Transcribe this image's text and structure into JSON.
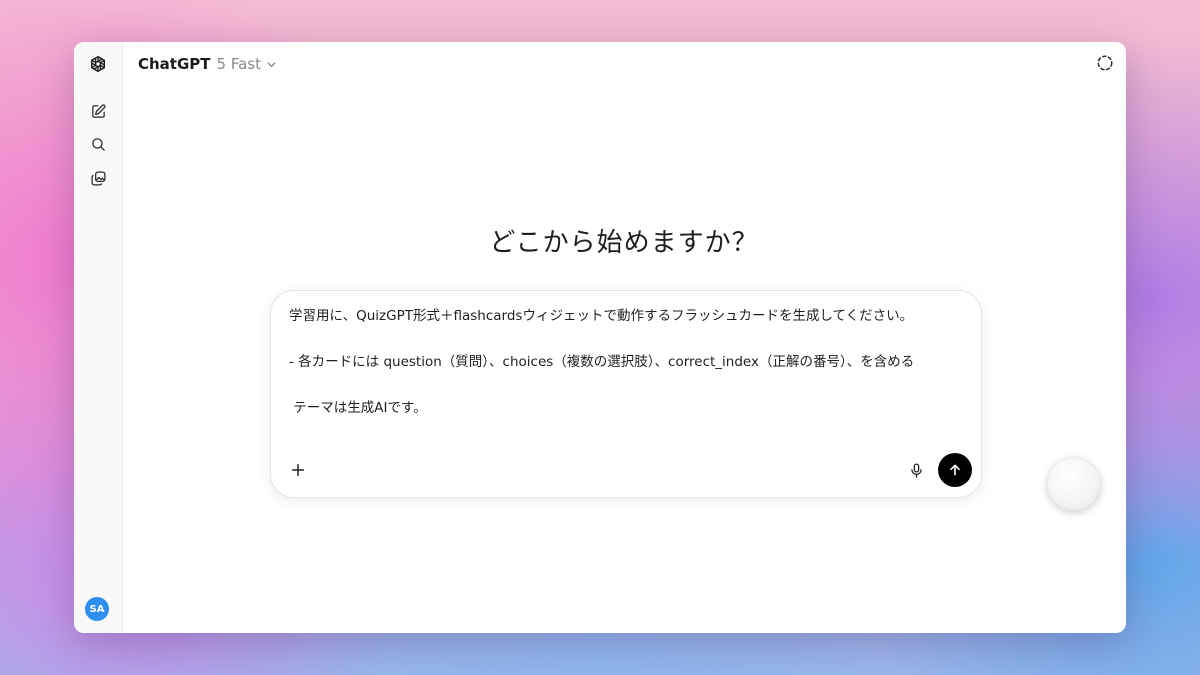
{
  "header": {
    "app_name": "ChatGPT",
    "model_variant": "5 Fast"
  },
  "main": {
    "headline": "どこから始めますか？"
  },
  "composer": {
    "text": "学習用に、QuizGPT形式＋flashcardsウィジェットで動作するフラッシュカードを生成してください。\n\n- 各カードには question（質問）、choices（複数の選択肢）、correct_index（正解の番号）、を含める\n\n テーマは生成AIです。"
  },
  "sidebar": {
    "avatar_initials": "SA"
  },
  "icons": {
    "logo": "openai-logo-icon",
    "new_chat": "edit-icon",
    "search": "search-icon",
    "library": "images-icon",
    "temporary_chat": "dashed-circle-icon",
    "attach": "plus-icon",
    "dictate": "microphone-icon",
    "send": "arrow-up-icon"
  },
  "colors": {
    "send_button": "#000000",
    "avatar": "#2e8ff0"
  }
}
